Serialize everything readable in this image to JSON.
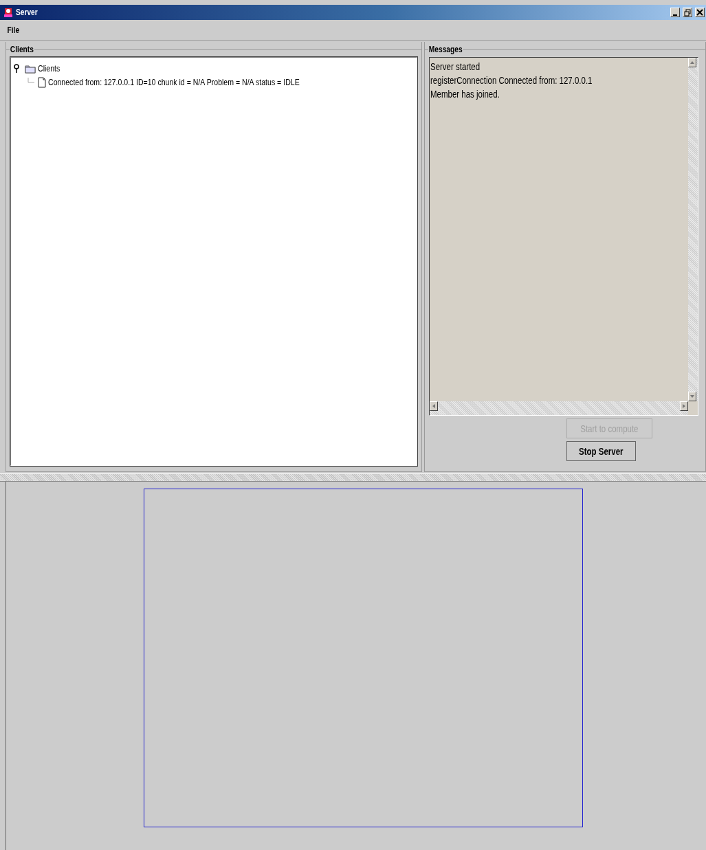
{
  "window": {
    "title": "Server"
  },
  "menu": [
    {
      "label": "File"
    }
  ],
  "clients_panel": {
    "title": "Clients",
    "tree": [
      {
        "label": "Clients",
        "expanded": true,
        "children": [
          {
            "label": "Connected from: 127.0.0.1 ID=10 chunk id =  N/A Problem = N/A status = IDLE"
          }
        ]
      }
    ]
  },
  "messages_panel": {
    "title": "Messages",
    "lines": [
      "Server started",
      "registerConnection Connected from: 127.0.0.1",
      "Member has joined."
    ]
  },
  "buttons": [
    {
      "label": "Start to compute",
      "disabled": true
    },
    {
      "label": "Stop Server",
      "disabled": false
    }
  ]
}
